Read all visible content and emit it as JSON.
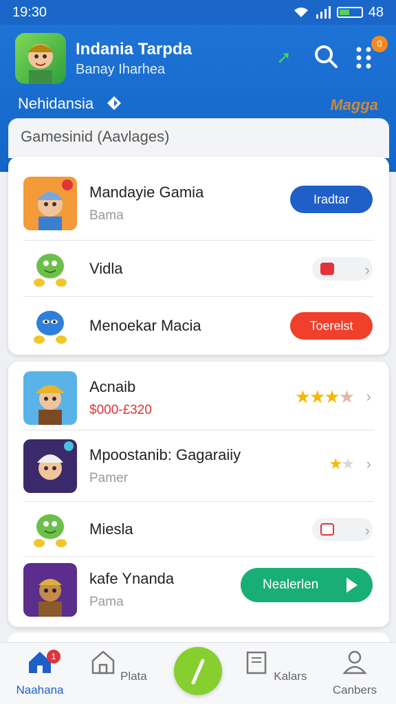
{
  "status": {
    "time": "19:30",
    "battery_label": "48"
  },
  "header": {
    "app_title": "Indania Tarpda",
    "app_subtitle": "Banay Iharhea",
    "region_label": "Nehidansia",
    "right_label": "Magga",
    "notification_count": "0"
  },
  "section": {
    "title": "Gamesinid (Aavlages)"
  },
  "card1": [
    {
      "title": "Mandayie Gamia",
      "subtitle": "Bama",
      "action": "Iradtar",
      "action_color": "#1e5fc8"
    },
    {
      "title": "Vidla",
      "subtitle": "",
      "action_type": "badge"
    },
    {
      "title": "Menoekar Macia",
      "subtitle": "",
      "action": "Toerelst",
      "action_color": "#f0402b"
    }
  ],
  "card2": [
    {
      "title": "Acnaib",
      "subtitle": "$000-£320",
      "rating": 3.5
    },
    {
      "title": "Mpoostanib: Gagaraiiy",
      "subtitle": "Pamer",
      "rating": 1
    },
    {
      "title": "Miesla",
      "subtitle": "",
      "action_type": "badge"
    },
    {
      "title": "kafe Ynanda",
      "subtitle": "Pama",
      "action": "Nealerlen",
      "action_color": "#1aae77"
    }
  ],
  "nav": {
    "items": [
      {
        "label": "Naahana",
        "icon": "home-icon",
        "badge": "1"
      },
      {
        "label": "Plata",
        "icon": "store-icon"
      },
      {
        "label": "",
        "icon": "center-action-icon"
      },
      {
        "label": "Kalars",
        "icon": "book-icon"
      },
      {
        "label": "Canbers",
        "icon": "user-icon"
      }
    ]
  }
}
